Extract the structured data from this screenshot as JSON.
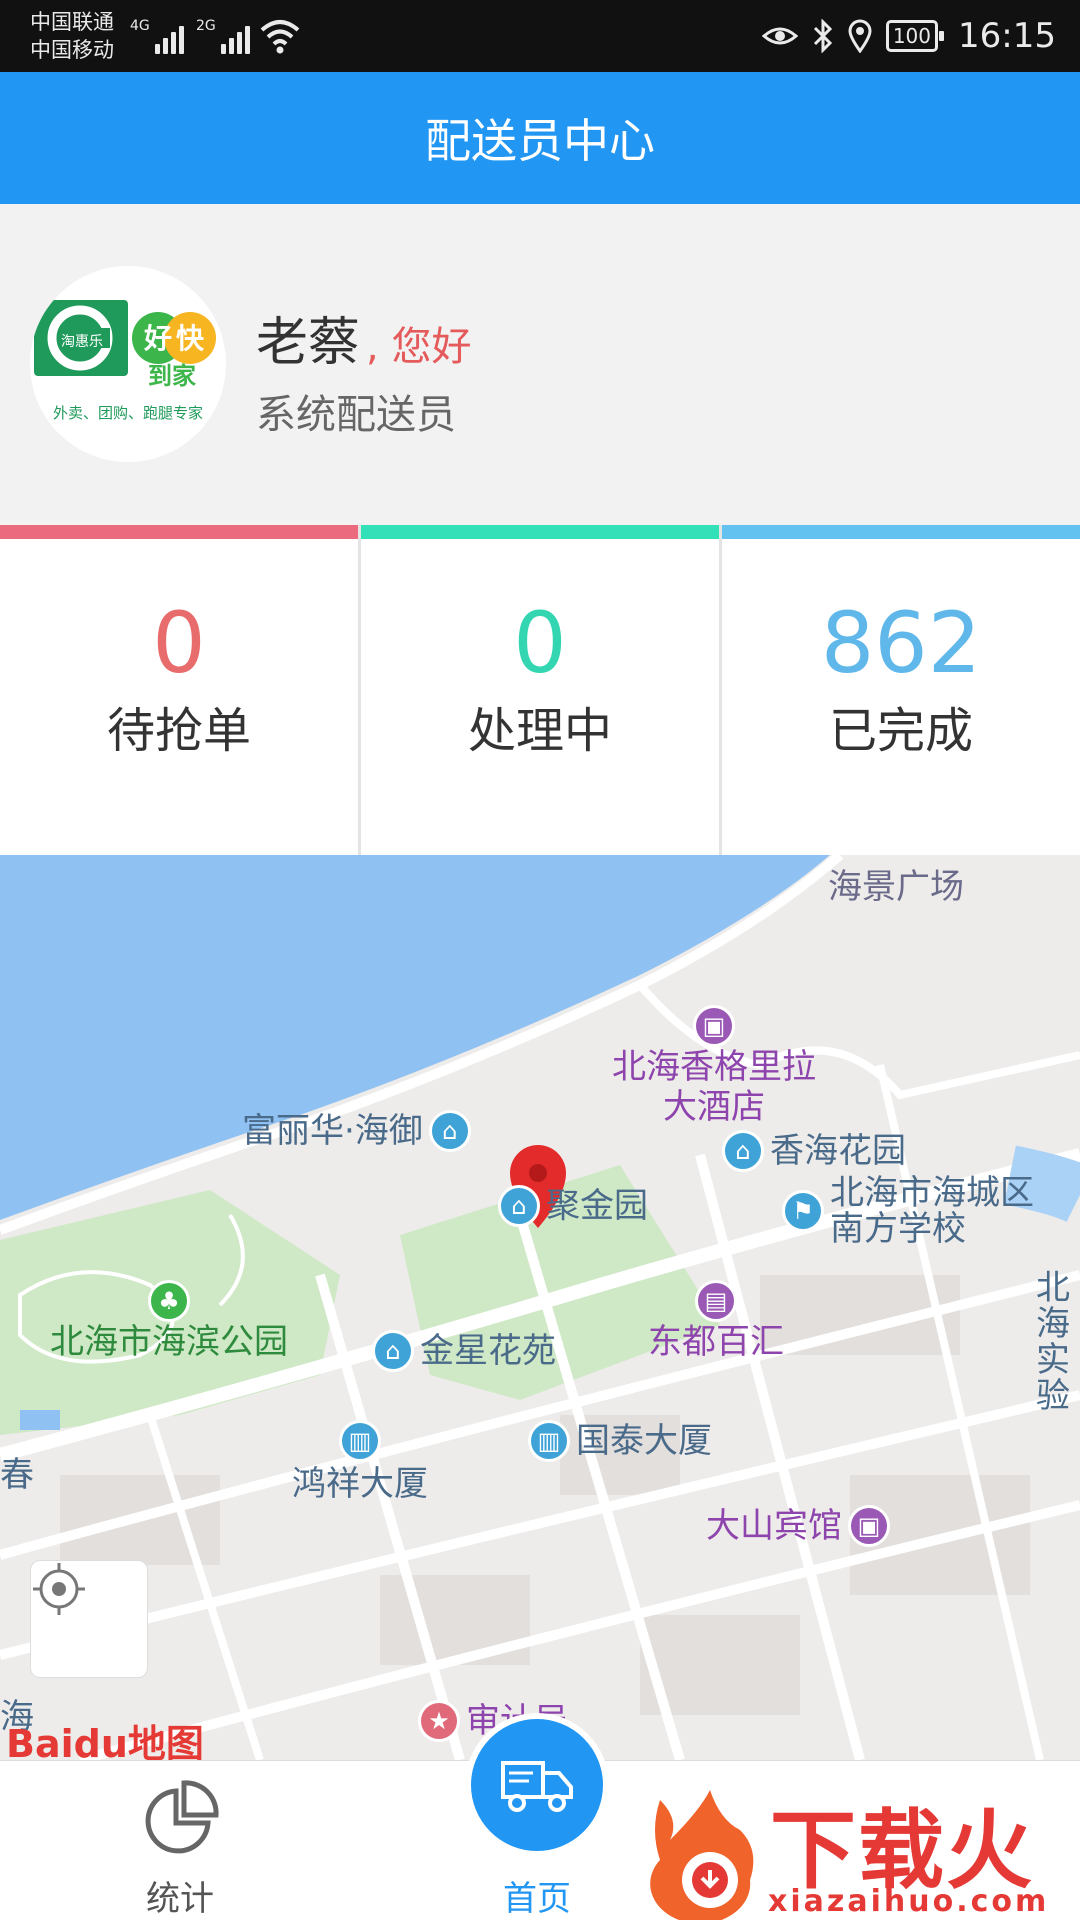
{
  "status_bar": {
    "carrier_1": "中国联通",
    "carrier_2": "中国移动",
    "net_1": "4G",
    "net_2": "2G",
    "battery": "100",
    "time": "16:15"
  },
  "header": {
    "title": "配送员中心"
  },
  "profile": {
    "name": "老蔡",
    "greeting": ", 您好",
    "role": "系统配送员",
    "avatar_logo": {
      "line1": "淘惠乐",
      "badge1": "好",
      "badge2": "快",
      "line2": "到家",
      "tagline": "外卖、团购、跑腿专家"
    }
  },
  "stats": [
    {
      "value": "0",
      "label": "待抢单",
      "color": "#e96c6c",
      "bar_color": "#ec6a7e"
    },
    {
      "value": "0",
      "label": "处理中",
      "color": "#33d6b0",
      "bar_color": "#33e0b8"
    },
    {
      "value": "862",
      "label": "已完成",
      "color": "#5fb7ea",
      "bar_color": "#64c2f0"
    }
  ],
  "map": {
    "pois": [
      {
        "name": "海景广场",
        "icon": "none"
      },
      {
        "name": "北海香格里拉\n大酒店",
        "icon": "hotel-icon"
      },
      {
        "name": "富丽华·海御",
        "icon": "building-icon"
      },
      {
        "name": "香海花园",
        "icon": "building-icon"
      },
      {
        "name": "聚金园",
        "icon": "building-icon"
      },
      {
        "name": "北海市海城区\n南方学校",
        "icon": "school-icon"
      },
      {
        "name": "北海市海滨公园",
        "icon": "park-icon"
      },
      {
        "name": "金星花苑",
        "icon": "building-icon"
      },
      {
        "name": "东都百汇",
        "icon": "shop-icon"
      },
      {
        "name": "国泰大厦",
        "icon": "office-icon"
      },
      {
        "name": "鸿祥大厦",
        "icon": "office-icon"
      },
      {
        "name": "大山宾馆",
        "icon": "hotel-icon"
      },
      {
        "name": "审计局",
        "icon": "gov-icon"
      },
      {
        "name": "北海\n实验",
        "icon": "none"
      },
      {
        "name": "春",
        "icon": "none"
      },
      {
        "name": "海",
        "icon": "none"
      }
    ],
    "attribution": "Baidu地图"
  },
  "bottom_nav": {
    "stats_label": "统计",
    "home_label": "首页"
  },
  "watermark": {
    "text": "下载火",
    "url": "xiazaihuo.com"
  }
}
